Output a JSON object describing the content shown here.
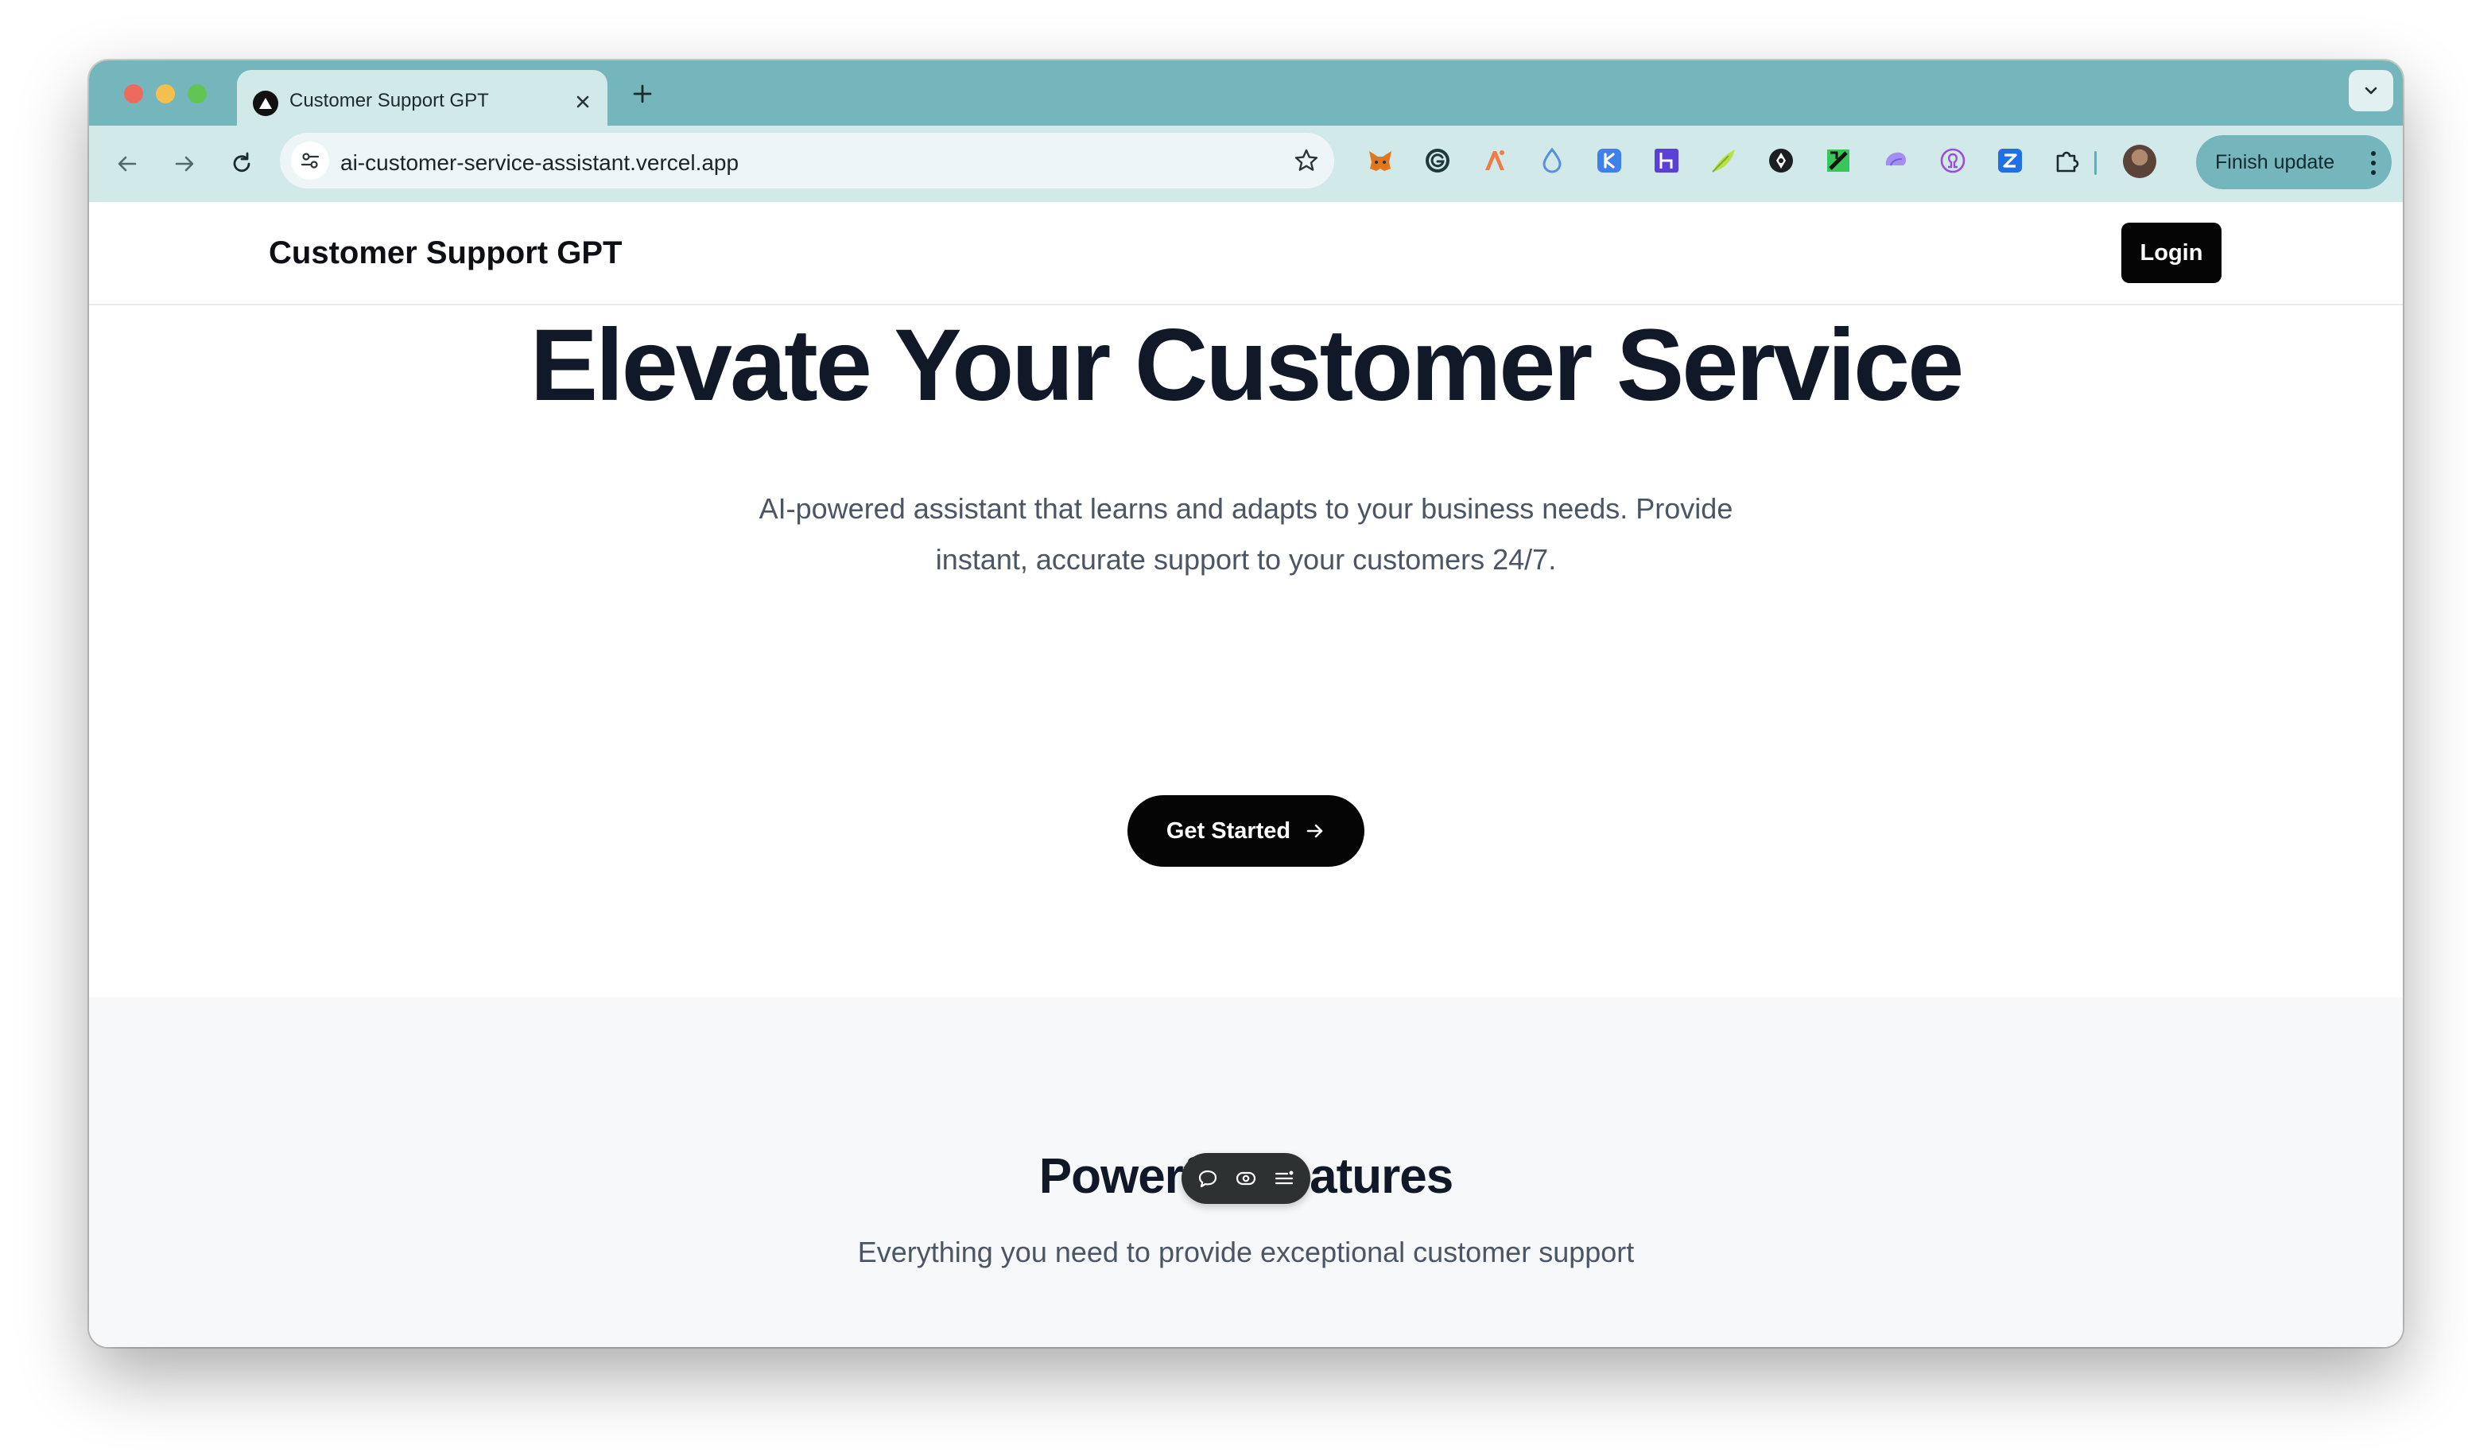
{
  "browser": {
    "tab_title": "Customer Support GPT",
    "url": "ai-customer-service-assistant.vercel.app",
    "finish_update_label": "Finish update",
    "extensions": [
      "metamask-icon",
      "grammarly-icon",
      "pen-tool-icon",
      "drop-icon",
      "k-extension-icon",
      "h-extension-icon",
      "leaf-icon",
      "compass-icon",
      "green-extension-icon",
      "brain-icon",
      "omega-icon",
      "z-extension-icon",
      "puzzle-icon"
    ]
  },
  "header": {
    "brand": "Customer Support GPT",
    "login_label": "Login"
  },
  "hero": {
    "title": "Elevate Your Customer Service",
    "subtitle_line1": "AI-powered assistant that learns and adapts to your business needs. Provide",
    "subtitle_line2": "instant, accurate support to your customers 24/7.",
    "cta_label": "Get Started"
  },
  "features": {
    "title": "Powerful Features",
    "subtitle": "Everything you need to provide exceptional customer support"
  },
  "colors": {
    "tab_strip": "#75b6bc",
    "toolbar": "#d2e9ea",
    "primary_button": "#050505",
    "heading": "#111827",
    "body_text": "#4b5563",
    "features_bg": "#f7f8fa"
  }
}
